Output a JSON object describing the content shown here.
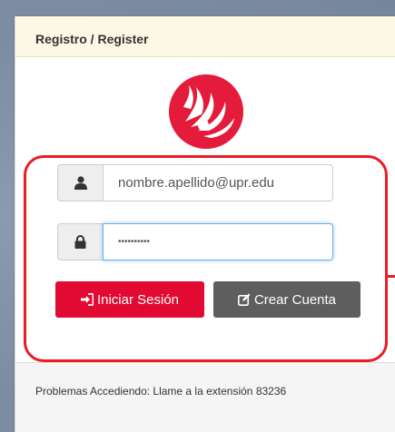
{
  "panel": {
    "title": "Registro / Register"
  },
  "login_form": {
    "username_value": "nombre.apellido@upr.edu",
    "password_value": "••••••••••",
    "login_button": "Iniciar Sesión",
    "create_account_button": "Crear Cuenta"
  },
  "footer": {
    "help_text": "Problemas Accediendo: Llame a la extensión 83236"
  },
  "colors": {
    "brand_red": "#e20a32",
    "header_bg": "#fcf8e3",
    "annotation_red": "#ea1c24",
    "secondary_button": "#5e5e5e"
  },
  "icons": {
    "username": "user-icon",
    "password": "lock-icon",
    "login": "sign-in-icon",
    "create_account": "edit-icon",
    "logo": "flame-bird-logo"
  }
}
